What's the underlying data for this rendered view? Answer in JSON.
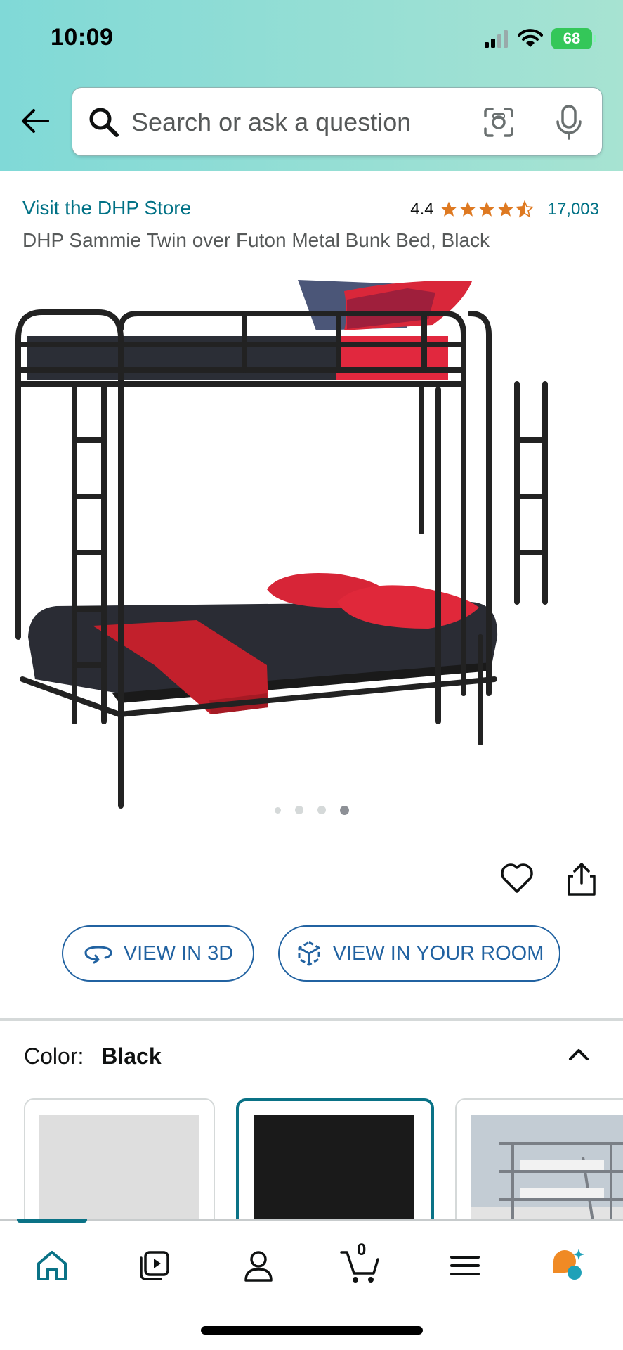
{
  "status_bar": {
    "time": "10:09",
    "battery": "68"
  },
  "search": {
    "placeholder": "Search or ask a question"
  },
  "product": {
    "store_link": "Visit the DHP Store",
    "rating": "4.4",
    "rating_count": "17,003",
    "title": "DHP Sammie Twin over Futon Metal Bunk Bed, Black",
    "image_count": 4,
    "active_image": 4
  },
  "actions": {
    "view_3d": "VIEW IN 3D",
    "view_room": "VIEW IN YOUR ROOM"
  },
  "color": {
    "label": "Color:",
    "value": "Black"
  },
  "nav": {
    "cart_count": "0"
  },
  "colors": {
    "accent": "#007185",
    "link_blue": "#2162a1",
    "star": "#de7921",
    "selected": "#0a7286"
  },
  "icons": [
    "back-arrow-icon",
    "search-icon",
    "camera-icon",
    "mic-icon",
    "heart-icon",
    "share-icon",
    "view-3d-icon",
    "ar-cube-icon",
    "chevron-up-icon",
    "home-icon",
    "video-icon",
    "account-icon",
    "cart-icon",
    "menu-icon",
    "rufus-icon"
  ]
}
